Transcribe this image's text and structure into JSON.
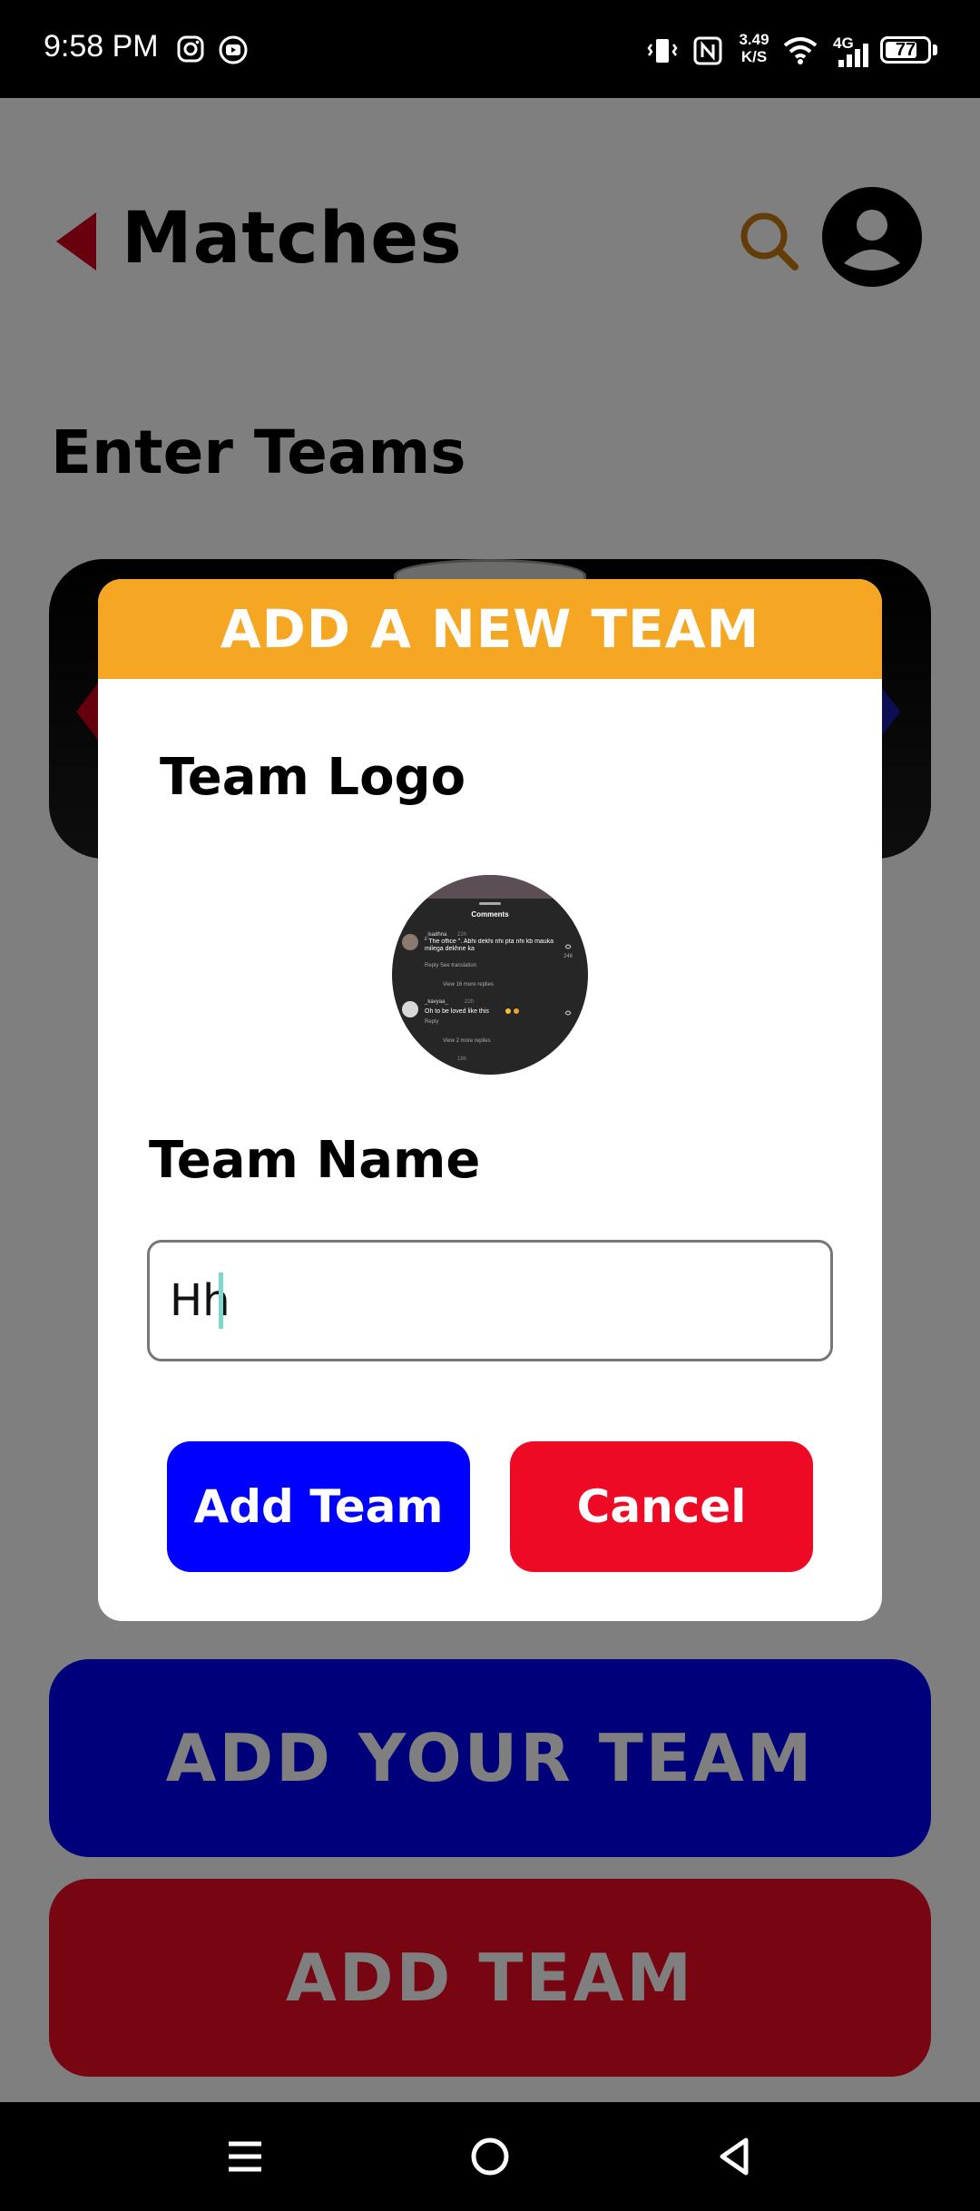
{
  "status_bar": {
    "time": "9:58 PM",
    "net_speed_value": "3.49",
    "net_speed_unit": "K/S",
    "network_type": "4G",
    "battery": "77",
    "battery_level": 0.77,
    "icons": [
      "instagram-icon",
      "download-icon",
      "vibrate-icon",
      "nfc-icon",
      "wifi-icon",
      "signal-icon",
      "battery-icon"
    ]
  },
  "header": {
    "title": "Matches",
    "back_icon": "back-arrow-icon",
    "search_icon": "search-icon",
    "avatar_icon": "person-icon",
    "accent_color": "#d0021b",
    "search_color": "#c57a12"
  },
  "page": {
    "section_title": "Enter Teams",
    "add_your_team_label": "ADD YOUR TEAM",
    "add_team_label": "ADD TEAM"
  },
  "dialog": {
    "title": "ADD A NEW TEAM",
    "logo_label": "Team Logo",
    "name_label": "Team Name",
    "name_value": "Hh",
    "add_button_label": "Add Team",
    "cancel_button_label": "Cancel",
    "header_color": "#f5a623",
    "add_color": "#0000ff",
    "cancel_color": "#ee0a24"
  },
  "logo_preview": {
    "title": "Comments",
    "comments": [
      {
        "user": "_isadhna",
        "age": "22h",
        "text": "\" The office \". Abhi dekhi nhi pta nhi kb mauka milega dekhne ka",
        "meta": "Reply   See translation",
        "likes": "246",
        "replies": "View 16 more replies"
      },
      {
        "user": "_kavyaa_",
        "age": "22h",
        "text": "Oh to be loved like this",
        "meta": "Reply",
        "likes": "",
        "replies": "View 2 more replies"
      },
      {
        "user": "",
        "age": "18h",
        "text": "",
        "meta": "",
        "likes": "",
        "replies": ""
      }
    ]
  },
  "nav_bar": {
    "icons": [
      "menu-icon",
      "home-icon",
      "back-icon"
    ]
  }
}
